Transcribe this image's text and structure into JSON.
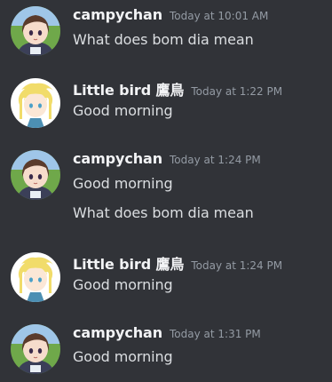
{
  "messages": [
    {
      "author": "campychan",
      "avatar": "campychan-avatar",
      "timestamp": "Today at 10:01 AM",
      "lines": [
        "What does bom dia mean"
      ]
    },
    {
      "author": "Little bird 鷹鳥",
      "avatar": "little-bird-avatar",
      "timestamp": "Today at 1:22 PM",
      "lines": [
        "Good morning"
      ]
    },
    {
      "author": "campychan",
      "avatar": "campychan-avatar",
      "timestamp": "Today at 1:24 PM",
      "lines": [
        "Good morning",
        "What does bom dia mean"
      ]
    },
    {
      "author": "Little bird 鷹鳥",
      "avatar": "little-bird-avatar",
      "timestamp": "Today at 1:24 PM",
      "lines": [
        "Good morning"
      ]
    },
    {
      "author": "campychan",
      "avatar": "campychan-avatar",
      "timestamp": "Today at 1:31 PM",
      "lines": [
        "Good morning"
      ]
    }
  ],
  "colors": {
    "background": "#313338",
    "username": "#f2f3f5",
    "timestamp": "#949ba4",
    "text": "#dbdee1"
  }
}
